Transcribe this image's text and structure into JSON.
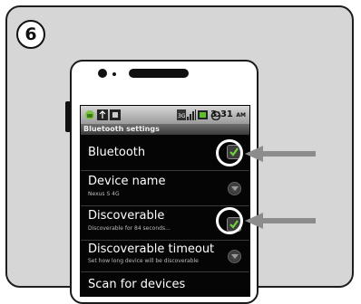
{
  "step_number": "6",
  "status_bar": {
    "time": "3:31",
    "ampm": "AM"
  },
  "screen_title": "Bluetooth settings",
  "settings": {
    "bluetooth": {
      "title": "Bluetooth",
      "checked": true
    },
    "device_name": {
      "title": "Device name",
      "subtitle": "Nexus S 4G"
    },
    "discoverable": {
      "title": "Discoverable",
      "subtitle": "Discoverable for 84 seconds...",
      "checked": true
    },
    "discoverable_timeout": {
      "title": "Discoverable timeout",
      "subtitle": "Set how long device will be discoverable"
    },
    "scan": {
      "title": "Scan for devices"
    }
  },
  "colors": {
    "panel": "#d6d6d6",
    "screen": "#050505",
    "check": "#6fd13a",
    "arrow": "#8c8c8c"
  }
}
